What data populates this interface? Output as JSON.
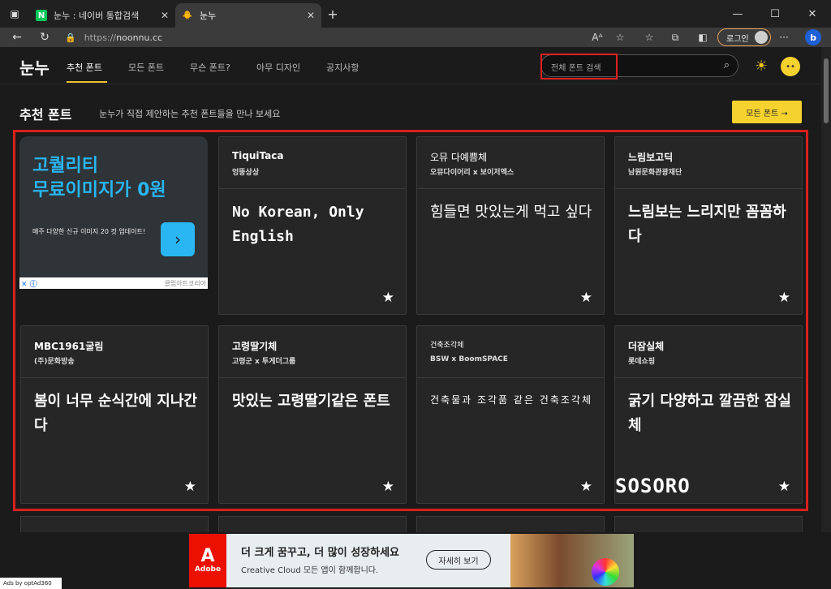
{
  "browser": {
    "tabs": [
      {
        "title": "눈누 : 네이버 통합검색",
        "favicon": "N"
      },
      {
        "title": "눈누",
        "favicon": "🐥"
      }
    ],
    "new_tab": "+",
    "url_prefix": "https://",
    "url_host": "noonnu.cc",
    "login_label": "로그인"
  },
  "site": {
    "logo": "눈누",
    "nav": [
      "추천 폰트",
      "모든 폰트",
      "무슨 폰트?",
      "아무 디자인",
      "공지사항"
    ],
    "search_placeholder": "전체 폰트 검색"
  },
  "section": {
    "title": "추천 폰트",
    "subtitle": "눈누가 직접 제안하는 추천 폰트들을 만나 보세요",
    "all_fonts_btn": "모든 폰트 →"
  },
  "ad_card": {
    "line1": "고퀄리티",
    "line2": "무료이미지가 0원",
    "desc": "매주 다양한 신규 이미지 20 컷 업데이트!",
    "source": "클립아트코리아"
  },
  "cards": [
    {
      "name": "TiquiTaca",
      "maker": "엉뚱상상",
      "sample": "No Korean, Only English"
    },
    {
      "name": "오뮤 다예쁨체",
      "maker": "오뮤다이어리 x 보이저엑스",
      "sample": "힘들면 맛있는게 먹고 싶다"
    },
    {
      "name": "느림보고딕",
      "maker": "남원문화관광재단",
      "sample": "느림보는 느리지만 꼼꼼하다"
    },
    {
      "name": "MBC1961굴림",
      "maker": "(주)문화방송",
      "sample": "봄이 너무 순식간에 지나간다"
    },
    {
      "name": "고령딸기체",
      "maker": "고령군 x 투게더그룹",
      "sample": "맛있는 고령딸기같은 폰트"
    },
    {
      "name": "건축조각체",
      "maker": "BSW x BoomSPACE",
      "sample": "건축물과 조각품 같은 건축조각체"
    },
    {
      "name": "더잠실체",
      "maker": "롯데쇼핑",
      "sample": "굵기 다양하고 깔끔한 잠실체"
    }
  ],
  "sosoro": "SOSORO",
  "bottom_ad": {
    "brand": "Adobe",
    "headline": "더 크게 꿈꾸고, 더 많이 성장하세요",
    "sub": "Creative Cloud 모든 앱이 함께합니다.",
    "cta": "자세히 보기",
    "ads_by": "Ads by optAd360"
  },
  "colors": {
    "accent": "#f6d22f",
    "highlight": "#d8201e",
    "ad_blue": "#29b6f2"
  }
}
